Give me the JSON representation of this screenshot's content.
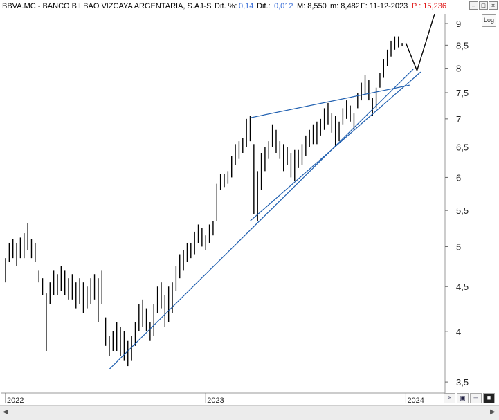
{
  "header": {
    "ticker_name": "BBVA.MC - BANCO BILBAO VIZCAYA ARGENTARIA, S.A. -",
    "period": "1 S",
    "dif_pct_label": "Dif. %:",
    "dif_pct_value": "0,14",
    "dif_label": "Dif.:",
    "dif_value": "0,012",
    "max_label": "M: 8,550",
    "min_label": "m: 8,482",
    "date_label": "F: 11-12-2023",
    "price_label": "P : 15,236"
  },
  "window_buttons": [
    "–",
    "□",
    "×"
  ],
  "log_button": "Log",
  "colors": {
    "bars": "#000000",
    "trendline": "#1f5fb0",
    "projection": "#000000",
    "accent_blue": "#3a6ed8",
    "accent_red": "#e01818"
  },
  "chart_data": {
    "type": "ohlc",
    "scale": "log",
    "ylim": [
      3.4,
      9.3
    ],
    "y_ticks": [
      "9",
      "8,5",
      "8",
      "7,5",
      "7",
      "6,5",
      "6",
      "5,5",
      "5",
      "4,5",
      "4",
      "3,5"
    ],
    "x_ticks": [
      "2022",
      "2023",
      "2024"
    ],
    "bars_weekly": [
      [
        0,
        4.85,
        4.55
      ],
      [
        1,
        5.05,
        4.8
      ],
      [
        2,
        5.1,
        4.85
      ],
      [
        3,
        5.05,
        4.75
      ],
      [
        4,
        5.12,
        4.85
      ],
      [
        5,
        5.18,
        4.85
      ],
      [
        6,
        5.32,
        4.95
      ],
      [
        7,
        5.1,
        4.85
      ],
      [
        8,
        5.05,
        4.8
      ],
      [
        9,
        4.7,
        4.55
      ],
      [
        10,
        4.6,
        4.4
      ],
      [
        11,
        4.42,
        3.8
      ],
      [
        12,
        4.55,
        4.3
      ],
      [
        13,
        4.7,
        4.4
      ],
      [
        14,
        4.65,
        4.4
      ],
      [
        15,
        4.75,
        4.45
      ],
      [
        16,
        4.7,
        4.4
      ],
      [
        17,
        4.6,
        4.35
      ],
      [
        18,
        4.65,
        4.35
      ],
      [
        19,
        4.55,
        4.25
      ],
      [
        20,
        4.6,
        4.3
      ],
      [
        21,
        4.55,
        4.2
      ],
      [
        22,
        4.5,
        4.25
      ],
      [
        23,
        4.6,
        4.3
      ],
      [
        24,
        4.65,
        4.35
      ],
      [
        25,
        4.6,
        4.1
      ],
      [
        26,
        4.7,
        4.3
      ],
      [
        27,
        4.15,
        3.85
      ],
      [
        28,
        3.95,
        3.75
      ],
      [
        29,
        4.0,
        3.8
      ],
      [
        30,
        4.1,
        3.8
      ],
      [
        31,
        4.05,
        3.75
      ],
      [
        32,
        4.0,
        3.7
      ],
      [
        33,
        3.9,
        3.65
      ],
      [
        34,
        3.95,
        3.7
      ],
      [
        35,
        4.1,
        3.85
      ],
      [
        36,
        4.3,
        4.0
      ],
      [
        37,
        4.35,
        4.05
      ],
      [
        38,
        4.25,
        4.0
      ],
      [
        39,
        4.1,
        3.9
      ],
      [
        40,
        4.3,
        3.95
      ],
      [
        41,
        4.5,
        4.2
      ],
      [
        42,
        4.55,
        4.25
      ],
      [
        43,
        4.4,
        4.05
      ],
      [
        44,
        4.5,
        4.1
      ],
      [
        45,
        4.55,
        4.2
      ],
      [
        46,
        4.75,
        4.45
      ],
      [
        47,
        4.9,
        4.6
      ],
      [
        48,
        4.95,
        4.7
      ],
      [
        49,
        5.05,
        4.8
      ],
      [
        50,
        5.05,
        4.85
      ],
      [
        51,
        5.2,
        4.9
      ],
      [
        52,
        5.3,
        5.05
      ],
      [
        53,
        5.25,
        5.0
      ],
      [
        54,
        5.15,
        4.95
      ],
      [
        55,
        5.3,
        5.05
      ],
      [
        56,
        5.35,
        5.15
      ],
      [
        57,
        5.9,
        5.35
      ],
      [
        58,
        6.05,
        5.8
      ],
      [
        59,
        6.05,
        5.85
      ],
      [
        60,
        6.1,
        5.9
      ],
      [
        61,
        6.35,
        6.0
      ],
      [
        62,
        6.55,
        6.2
      ],
      [
        63,
        6.6,
        6.3
      ],
      [
        64,
        6.65,
        6.4
      ],
      [
        65,
        7.0,
        6.5
      ],
      [
        66,
        7.05,
        6.6
      ],
      [
        67,
        6.55,
        5.45
      ],
      [
        68,
        6.1,
        5.35
      ],
      [
        69,
        6.4,
        5.8
      ],
      [
        70,
        6.5,
        6.1
      ],
      [
        71,
        6.6,
        6.3
      ],
      [
        72,
        6.9,
        6.5
      ],
      [
        73,
        6.8,
        6.4
      ],
      [
        74,
        6.6,
        6.3
      ],
      [
        75,
        6.55,
        6.1
      ],
      [
        76,
        6.5,
        6.2
      ],
      [
        77,
        6.4,
        6.0
      ],
      [
        78,
        6.45,
        5.95
      ],
      [
        79,
        6.45,
        6.15
      ],
      [
        80,
        6.55,
        6.2
      ],
      [
        81,
        6.7,
        6.35
      ],
      [
        82,
        6.8,
        6.5
      ],
      [
        83,
        6.9,
        6.55
      ],
      [
        84,
        6.95,
        6.55
      ],
      [
        85,
        7.0,
        6.7
      ],
      [
        86,
        7.2,
        6.8
      ],
      [
        87,
        7.3,
        6.9
      ],
      [
        88,
        7.1,
        6.75
      ],
      [
        89,
        7.05,
        6.5
      ],
      [
        90,
        6.95,
        6.6
      ],
      [
        91,
        7.2,
        6.9
      ],
      [
        92,
        7.35,
        7.0
      ],
      [
        93,
        7.25,
        6.95
      ],
      [
        94,
        7.1,
        6.8
      ],
      [
        95,
        7.5,
        7.2
      ],
      [
        96,
        7.7,
        7.35
      ],
      [
        97,
        7.85,
        7.45
      ],
      [
        98,
        7.75,
        7.35
      ],
      [
        99,
        7.4,
        7.05
      ],
      [
        100,
        7.6,
        7.2
      ],
      [
        101,
        7.9,
        7.6
      ],
      [
        102,
        8.2,
        7.8
      ],
      [
        103,
        8.4,
        8.05
      ],
      [
        104,
        8.6,
        8.25
      ],
      [
        105,
        8.7,
        8.4
      ],
      [
        106,
        8.7,
        8.45
      ],
      [
        107,
        8.55,
        8.48
      ]
    ],
    "trendlines": [
      {
        "from": [
          28,
          3.62
        ],
        "to": [
          110,
          7.98
        ]
      },
      {
        "from": [
          66,
          5.35
        ],
        "to": [
          112,
          7.92
        ]
      },
      {
        "from": [
          66,
          7.02
        ],
        "to": [
          109,
          7.65
        ]
      }
    ],
    "projection": {
      "points": [
        [
          108,
          8.55
        ],
        [
          111,
          7.95
        ],
        [
          117,
          9.6
        ]
      ]
    },
    "x_tick_positions": [
      [
        0,
        "2022"
      ],
      [
        54,
        "2023"
      ],
      [
        108,
        "2024"
      ]
    ]
  }
}
